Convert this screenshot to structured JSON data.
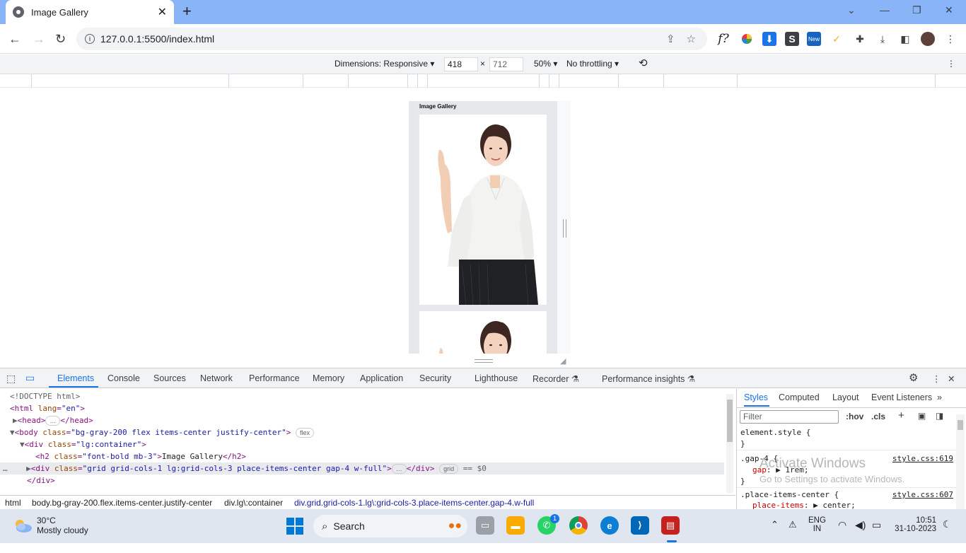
{
  "browser": {
    "tab_title": "Image Gallery",
    "url": "127.0.0.1:5500/index.html"
  },
  "device_toolbar": {
    "dimensions_label": "Dimensions: Responsive",
    "width": "418",
    "height": "712",
    "zoom": "50%",
    "throttling": "No throttling"
  },
  "page": {
    "heading": "Image Gallery"
  },
  "devtools": {
    "tabs": [
      "Elements",
      "Console",
      "Sources",
      "Network",
      "Performance",
      "Memory",
      "Application",
      "Security",
      "Lighthouse",
      "Recorder",
      "Performance insights"
    ],
    "dom": {
      "doctype": "<!DOCTYPE html>",
      "html_open": "<html",
      "html_attr": "lang",
      "html_val": "\"en\"",
      "head": "<head>",
      "head_close": "</head>",
      "body_open": "<body",
      "body_attr": "class",
      "body_val": "\"bg-gray-200 flex items-center justify-center\"",
      "body_pill": "flex",
      "div1_attr": "class",
      "div1_val": "\"lg:container\"",
      "h2_attr": "class",
      "h2_val": "\"font-bold mb-3\"",
      "h2_text": "Image Gallery",
      "div2_attr": "class",
      "div2_val": "\"grid grid-cols-1 lg:grid-cols-3 place-items-center gap-4 w-full\"",
      "div2_pill": "grid",
      "div2_suffix": "== $0",
      "close_div": "</div>"
    },
    "breadcrumbs": [
      "html",
      "body.bg-gray-200.flex.items-center.justify-center",
      "div.lg\\:container",
      "div.grid.grid-cols-1.lg\\:grid-cols-3.place-items-center.gap-4.w-full"
    ],
    "styles_tabs": [
      "Styles",
      "Computed",
      "Layout",
      "Event Listeners"
    ],
    "filter_placeholder": "Filter",
    "hov": ":hov",
    "cls": ".cls",
    "rules": {
      "element_style": "element.style {",
      "close": "}",
      "gap_selector": ".gap-4 {",
      "gap_prop": "gap",
      "gap_val": "1rem;",
      "gap_src": "style.css:619",
      "place_selector": ".place-items-center {",
      "place_prop": "place-items",
      "place_val": "center;",
      "place_src": "style.css:607"
    },
    "watermark_title": "Activate Windows",
    "watermark_sub": "Go to Settings to activate Windows."
  },
  "taskbar": {
    "temperature": "30°C",
    "condition": "Mostly cloudy",
    "search": "Search",
    "lang1": "ENG",
    "lang2": "IN",
    "time": "10:51",
    "date": "31-10-2023",
    "whatsapp_badge": "1"
  },
  "colors": {
    "titlebar": "#8ab4f8",
    "accent": "#1a73e8"
  }
}
